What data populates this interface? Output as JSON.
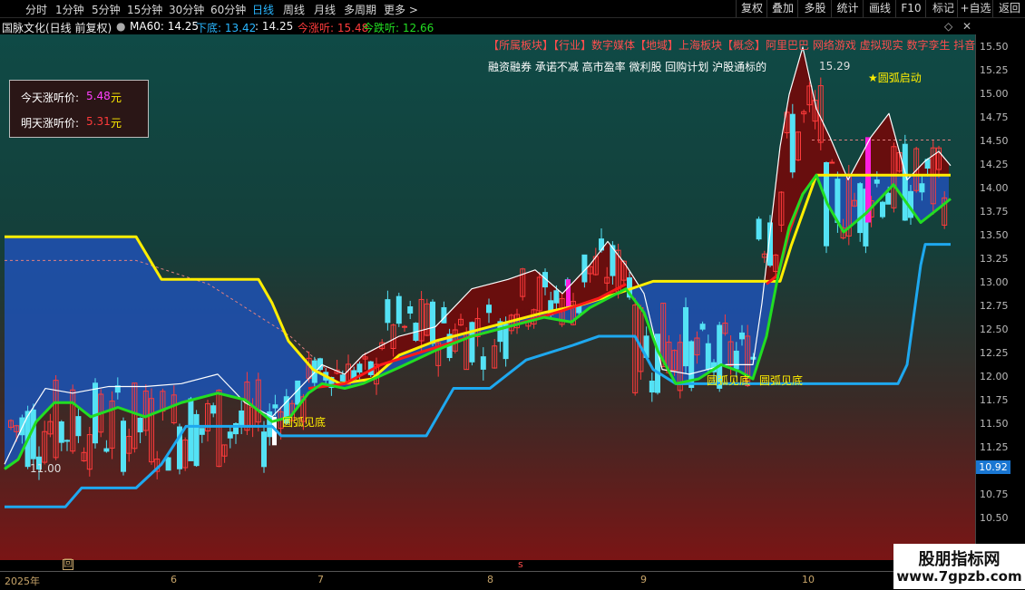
{
  "timeframes": [
    "分时",
    "1分钟",
    "5分钟",
    "15分钟",
    "30分钟",
    "60分钟",
    "日线",
    "周线",
    "月线",
    "多周期",
    "更多 >"
  ],
  "active_timeframe": "日线",
  "right_buttons": [
    "复权",
    "叠加",
    "多股",
    "统计",
    "画线",
    "F10",
    "+自选",
    "返回"
  ],
  "extra_button": "标记",
  "info": {
    "stock": "国脉文化(日线 前复权)",
    "ma_label": "MA60: 14.25",
    "xiadi_label": "下底: 13.42",
    "dot_value": ": 14.25",
    "jinzhangting": "今涨听: 15.48",
    "jindieting": "今跌听: 12.66"
  },
  "price_box": {
    "today_label": "今天涨听价:",
    "today_value": "5.48",
    "today_unit": "元",
    "tomorrow_label": "明天涨听价:",
    "tomorrow_value": "5.31",
    "tomorrow_unit": "元"
  },
  "concepts_line1": "【所属板块】【行业】数字媒体【地域】上海板块【概念】阿里巴巴 网络游戏 虚拟现实 数字孪生 抖音",
  "concepts_line2": "融资融券 承诺不减 高市盈率 微利股 回购计划 沪股通标的",
  "annotations": {
    "yuanhu_qidong": "★圆弧启动",
    "yuanhu_jiandi_1": "圆弧见底",
    "yuanhu_jiandi_2": "圆弧见底",
    "yuanhu_jiandi_3": "圆弧见底",
    "high_label": "15.29",
    "low_label": "11.00",
    "price_tag": "10.92"
  },
  "y_ticks": [
    "15.50",
    "15.25",
    "15.00",
    "14.75",
    "14.50",
    "14.25",
    "14.00",
    "13.75",
    "13.50",
    "13.25",
    "13.00",
    "12.75",
    "12.50",
    "12.25",
    "12.00",
    "11.75",
    "11.50",
    "11.25",
    "10.75",
    "10.50"
  ],
  "x_labels": [
    "2025年",
    "6",
    "7",
    "8",
    "9",
    "10"
  ],
  "x_markers": [
    "回",
    "s"
  ],
  "watermark": {
    "title": "股朋指标网",
    "url": "www.7gpzb.com"
  },
  "colors": {
    "up": "#ff3b3b",
    "down": "#54e2f5",
    "yellow": "#ffee00",
    "green": "#22dd22",
    "blue_line": "#1ea8ef",
    "mag": "#ff1fe0"
  },
  "chart_data": {
    "type": "candlestick",
    "ylim": [
      10.4,
      15.6
    ],
    "levels": {
      "ma60": 14.25,
      "xiadi": 13.42,
      "zhangting": 15.48,
      "dieting": 12.66,
      "high": 15.29,
      "low": 11.0,
      "last": 10.92
    }
  }
}
